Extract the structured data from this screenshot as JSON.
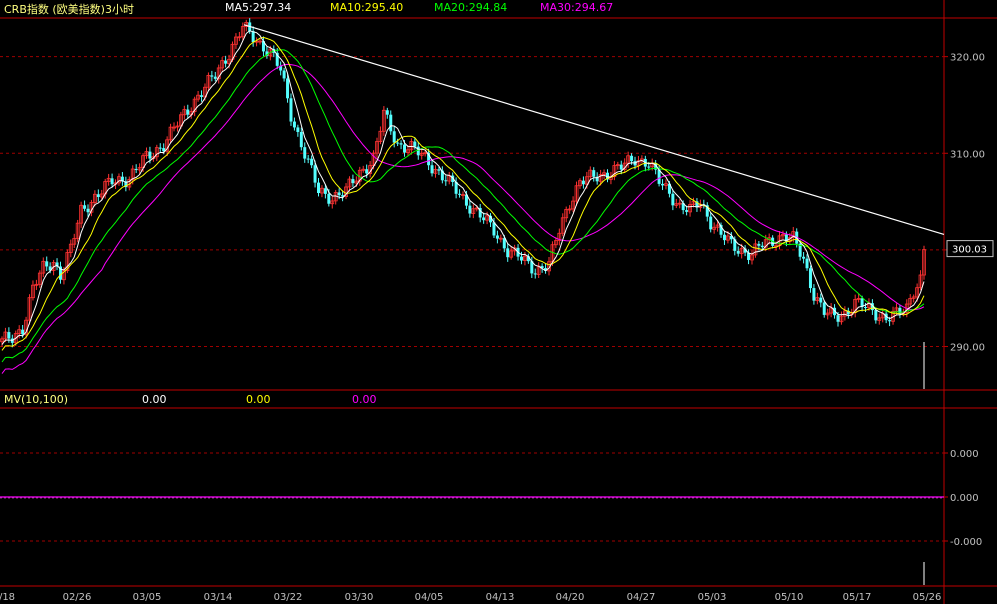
{
  "header": {
    "title": "CRB指数 (欧美指数)3小时",
    "ma5": "MA5:297.34",
    "ma10": "MA10:295.40",
    "ma20": "MA20:294.84",
    "ma30": "MA30:294.67"
  },
  "sub_panel": {
    "label": "MV(10,100)",
    "v1": "0.00",
    "v2": "0.00",
    "v3": "0.00"
  },
  "colors": {
    "up": "#ff3232",
    "down": "#54ffff",
    "ma5": "#ffffff",
    "ma10": "#ffff00",
    "ma20": "#00ff00",
    "ma30": "#ff00ff",
    "grid": "#a00000",
    "frame": "#c00000",
    "axis_text": "#c0c0c0",
    "trend": "#ffffff"
  },
  "chart_data": {
    "type": "candlestick",
    "x_tick_labels": [
      "/18",
      "02/26",
      "03/05",
      "03/14",
      "03/22",
      "03/30",
      "04/05",
      "04/13",
      "04/20",
      "04/27",
      "05/03",
      "05/10",
      "05/17",
      "05/26"
    ],
    "y_ticks": [
      290,
      300,
      310,
      320
    ],
    "y_tick_labels": [
      "290.00",
      "300.00",
      "310.00",
      "320.00"
    ],
    "ylim": [
      285.5,
      324
    ],
    "last_value_label": "300.03",
    "sub_y_tick_labels": [
      "0.000",
      "0.000",
      "-0.000"
    ],
    "close_anchors": [
      [
        0,
        290.5
      ],
      [
        3,
        290.8
      ],
      [
        6,
        292
      ],
      [
        9,
        296
      ],
      [
        12,
        298
      ],
      [
        15,
        298.8
      ],
      [
        17,
        297.5
      ],
      [
        20,
        300
      ],
      [
        23,
        304
      ],
      [
        27,
        305.5
      ],
      [
        32,
        307
      ],
      [
        37,
        307.5
      ],
      [
        42,
        309.5
      ],
      [
        47,
        311
      ],
      [
        52,
        313.5
      ],
      [
        57,
        316
      ],
      [
        62,
        318
      ],
      [
        66,
        320.5
      ],
      [
        70,
        323
      ],
      [
        73,
        322
      ],
      [
        78,
        320.5
      ],
      [
        81,
        318.5
      ],
      [
        84,
        314
      ],
      [
        88,
        310
      ],
      [
        92,
        306
      ],
      [
        96,
        305.5
      ],
      [
        100,
        306
      ],
      [
        104,
        308
      ],
      [
        108,
        309.5
      ],
      [
        111,
        314
      ],
      [
        115,
        311
      ],
      [
        119,
        310.5
      ],
      [
        123,
        309.5
      ],
      [
        127,
        308
      ],
      [
        131,
        306.5
      ],
      [
        135,
        305
      ],
      [
        139,
        303.5
      ],
      [
        143,
        302
      ],
      [
        147,
        300
      ],
      [
        151,
        299
      ],
      [
        155,
        298
      ],
      [
        159,
        298.5
      ],
      [
        162,
        302
      ],
      [
        165,
        305
      ],
      [
        168,
        307
      ],
      [
        172,
        307.5
      ],
      [
        176,
        308
      ],
      [
        180,
        308.5
      ],
      [
        184,
        309.5
      ],
      [
        188,
        309
      ],
      [
        191,
        307
      ],
      [
        194,
        306
      ],
      [
        197,
        304.5
      ],
      [
        200,
        304
      ],
      [
        203,
        305
      ],
      [
        206,
        303
      ],
      [
        209,
        301.5
      ],
      [
        212,
        300.5
      ],
      [
        215,
        300
      ],
      [
        218,
        299.5
      ],
      [
        221,
        300.5
      ],
      [
        224,
        301
      ],
      [
        227,
        301.5
      ],
      [
        230,
        301
      ],
      [
        233,
        299
      ],
      [
        236,
        295.5
      ],
      [
        239,
        293.5
      ],
      [
        242,
        293
      ],
      [
        245,
        293.5
      ],
      [
        248,
        294.5
      ],
      [
        251,
        294
      ],
      [
        254,
        293.5
      ],
      [
        257,
        293
      ],
      [
        260,
        293.2
      ],
      [
        263,
        294
      ],
      [
        265,
        296
      ],
      [
        267,
        297
      ],
      [
        268,
        300
      ]
    ],
    "total_bars": 269,
    "ma_periods": {
      "ma5": 5,
      "ma10": 10,
      "ma20": 20,
      "ma30": 30
    },
    "mv_value": 0.0
  }
}
